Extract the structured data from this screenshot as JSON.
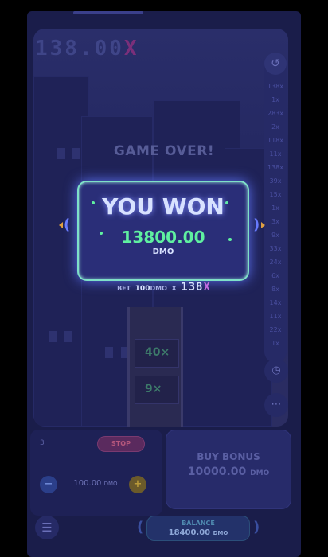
{
  "header": {
    "multiplier_value": "138.00",
    "multiplier_suffix": "X"
  },
  "scene": {
    "game_over": "GAME OVER!",
    "tower_floors": [
      "40×",
      "9×"
    ],
    "history": [
      "138x",
      "1x",
      "283x",
      "2x",
      "118x",
      "11x",
      "138x",
      "39x",
      "15x",
      "1x",
      "3x",
      "9x",
      "33x",
      "24x",
      "6x",
      "8x",
      "14x",
      "11x",
      "22x",
      "1x"
    ],
    "history_icon": "history-icon",
    "speed_icon": "speedometer-icon",
    "chat_icon": "chat-icon"
  },
  "win_card": {
    "title": "YOU WON",
    "amount": "13800.00",
    "currency": "DMO",
    "accent": "#5ff0a0",
    "border": "#7fe0c8"
  },
  "bet_line": {
    "bet_label": "BET",
    "bet_amount": "100",
    "bet_currency": "DMO",
    "times": "X",
    "multiplier": "138",
    "mult_suffix": "X"
  },
  "controls": {
    "auto_count": "3",
    "stop_label": "STOP",
    "minus": "−",
    "bet_value": "100.00",
    "bet_unit": "DMO",
    "plus": "+",
    "buy_bonus_title": "BUY BONUS",
    "buy_bonus_price": "10000.00",
    "buy_bonus_unit": "DMO",
    "menu_icon": "hamburger-icon",
    "balance_label": "BALANCE",
    "balance_value": "18400.00",
    "balance_unit": "DMO"
  }
}
